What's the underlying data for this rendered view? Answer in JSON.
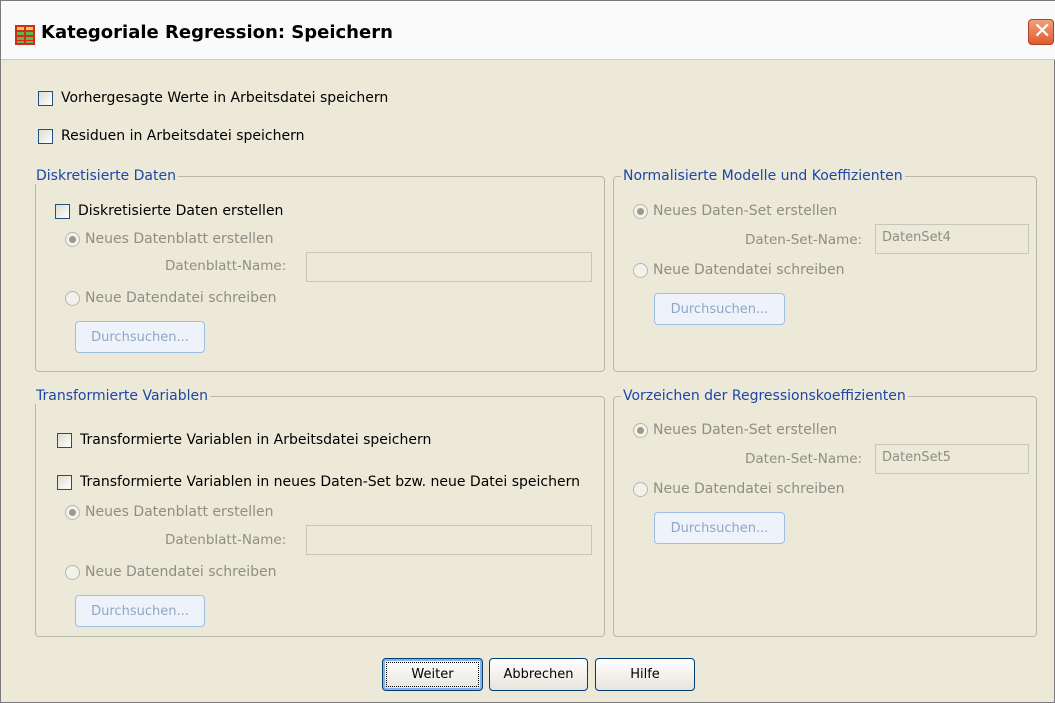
{
  "window": {
    "title": "Kategoriale Regression: Speichern"
  },
  "options": {
    "predicted": "Vorhergesagte Werte in Arbeitsdatei speichern",
    "residuals": "Residuen in Arbeitsdatei speichern"
  },
  "discretized": {
    "legend": "Diskretisierte Daten",
    "create": "Diskretisierte Daten erstellen",
    "new_sheet": "Neues Datenblatt erstellen",
    "sheet_name_label": "Datenblatt-Name:",
    "sheet_name_value": "",
    "write_file": "Neue Datendatei schreiben",
    "browse": "Durchsuchen..."
  },
  "normalized": {
    "legend": "Normalisierte Modelle und Koeffizienten",
    "new_dataset": "Neues Daten-Set erstellen",
    "dataset_name_label": "Daten-Set-Name:",
    "dataset_name_value": "DatenSet4",
    "write_file": "Neue Datendatei schreiben",
    "browse": "Durchsuchen..."
  },
  "transformed": {
    "legend": "Transformierte Variablen",
    "save_active": "Transformierte Variablen in Arbeitsdatei speichern",
    "save_new": "Transformierte Variablen in neues Daten-Set bzw. neue Datei speichern",
    "new_sheet": "Neues Datenblatt erstellen",
    "sheet_name_label": "Datenblatt-Name:",
    "sheet_name_value": "",
    "write_file": "Neue Datendatei schreiben",
    "browse": "Durchsuchen..."
  },
  "signs": {
    "legend": "Vorzeichen der Regressionskoeffizienten",
    "new_dataset": "Neues Daten-Set erstellen",
    "dataset_name_label": "Daten-Set-Name:",
    "dataset_name_value": "DatenSet5",
    "write_file": "Neue Datendatei schreiben",
    "browse": "Durchsuchen..."
  },
  "buttons": {
    "continue": "Weiter",
    "cancel": "Abbrechen",
    "help": "Hilfe"
  },
  "icons": {
    "app": "table-icon",
    "close": "close-icon"
  },
  "colors": {
    "dialog_bg": "#ece9d8",
    "legend": "#1d46a8",
    "disabled": "#8e8e86",
    "close": "#e05a2e"
  }
}
